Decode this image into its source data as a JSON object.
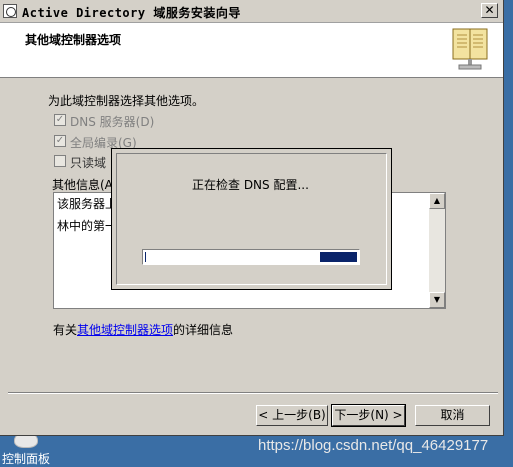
{
  "window": {
    "title": "Active Directory 域服务安装向导",
    "close_glyph": "✕"
  },
  "header": {
    "title": "其他域控制器选项",
    "icon": "book-icon"
  },
  "content": {
    "intro": "为此域控制器选择其他选项。",
    "options": [
      {
        "label": "DNS 服务器(D)",
        "checked": true,
        "enabled": false
      },
      {
        "label": "全局编录(G)",
        "checked": true,
        "enabled": false
      },
      {
        "label": "只读域",
        "checked": false,
        "enabled": false
      }
    ],
    "other_info_label": "其他信息(A",
    "info_lines": [
      "该服务器上",
      "林中的第一"
    ],
    "more_info_prefix": "有关",
    "more_info_link": "其他域控制器选项",
    "more_info_suffix": "的详细信息"
  },
  "progress_dialog": {
    "message": "正在检查 DNS 配置...",
    "progress_label": "indeterminate"
  },
  "buttons": {
    "back": "< 上一步(B)",
    "next": "下一步(N) >",
    "cancel": "取消"
  },
  "desktop": {
    "control_panel_label": "控制面板",
    "watermark": "https://blog.csdn.net/qq_46429177"
  }
}
